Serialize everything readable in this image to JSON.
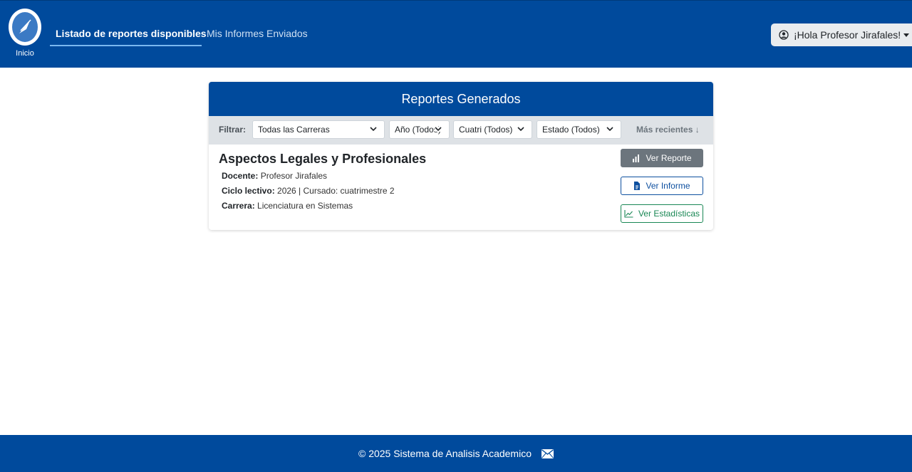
{
  "header": {
    "logo_label": "Inicio",
    "nav": [
      {
        "label": "Listado de reportes disponibles",
        "active": true
      },
      {
        "label": "Mis Informes Enviados",
        "active": false
      }
    ],
    "user_menu_label": "¡Hola Profesor Jirafales!",
    "colors": {
      "bar": "#004a9c"
    }
  },
  "card": {
    "title": "Reportes Generados",
    "filters": {
      "label": "Filtrar:",
      "carrera": "Todas las Carreras",
      "anio": "Año (Todos)",
      "cuatri": "Cuatri (Todos)",
      "estado": "Estado (Todos)",
      "sort": "Más recientes ↓"
    },
    "report": {
      "title": "Aspectos Legales y Profesionales",
      "docente_label": "Docente:",
      "docente": "Profesor Jirafales",
      "ciclo_label": "Ciclo lectivo:",
      "ciclo": "2026 | Cursado: cuatrimestre 2",
      "carrera_label": "Carrera:",
      "carrera": "Licenciatura en Sistemas",
      "buttons": {
        "ver_reporte": "Ver Reporte",
        "ver_informe": "Ver Informe",
        "ver_estadisticas": "Ver Estadísticas"
      }
    }
  },
  "footer": {
    "text": "© 2025 Sistema de Analisis Academico",
    "icon": "envelope-icon"
  }
}
